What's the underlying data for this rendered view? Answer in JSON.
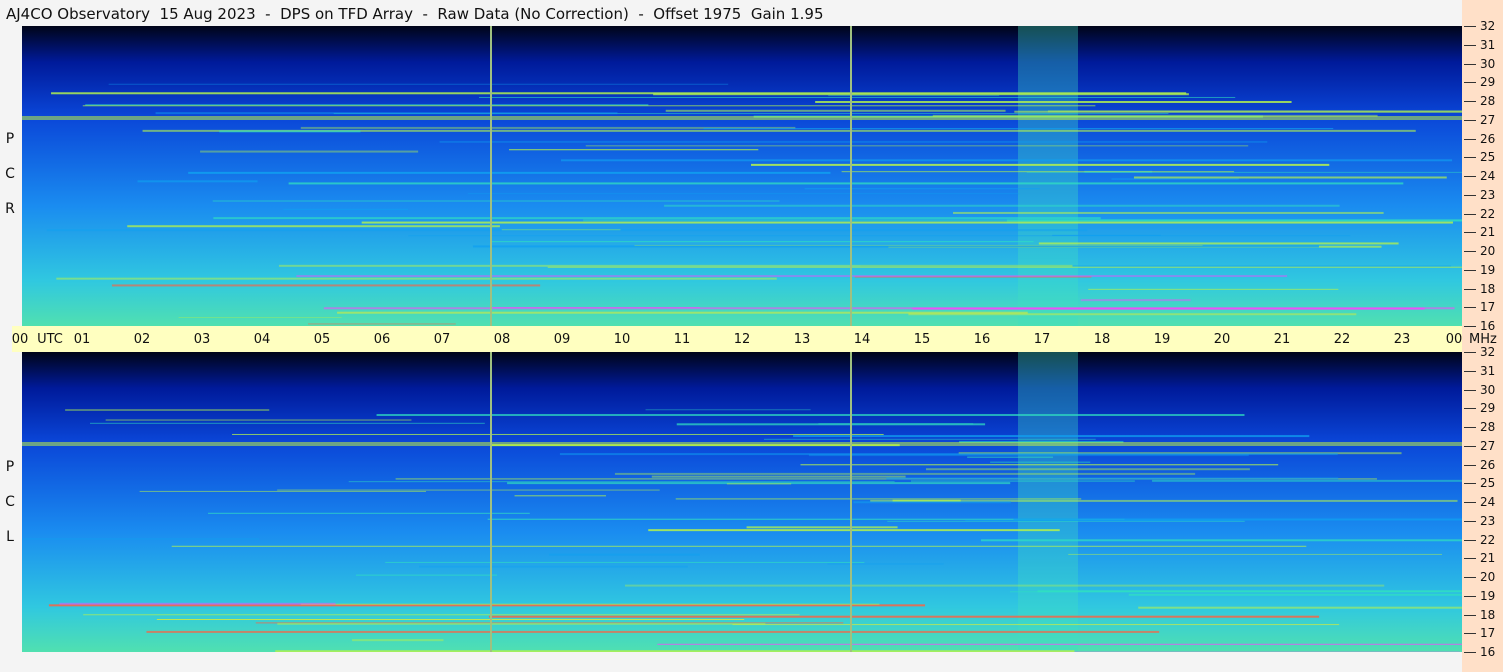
{
  "title": "AJ4CO Observatory  15 Aug 2023  -  DPS on TFD Array  -  Raw Data (No Correction)  -  Offset 1975  Gain 1.95",
  "chart_data": [
    {
      "type": "heatmap",
      "panel": "RCP",
      "side_label": [
        "R",
        "C",
        "P"
      ],
      "x_ticks": [
        "00",
        "01",
        "02",
        "03",
        "04",
        "05",
        "06",
        "07",
        "08",
        "09",
        "10",
        "11",
        "12",
        "13",
        "14",
        "15",
        "16",
        "17",
        "18",
        "19",
        "20",
        "21",
        "22",
        "23",
        "00"
      ],
      "x_unit_label": "UTC",
      "y_ticks": [
        16,
        17,
        18,
        19,
        20,
        21,
        22,
        23,
        24,
        25,
        26,
        27,
        28,
        29,
        30,
        31,
        32
      ],
      "y_unit_label": "MHz",
      "xlim": [
        0,
        24
      ],
      "ylim": [
        16,
        32
      ],
      "colormap": [
        "#000010",
        "#0010a0",
        "#0050e0",
        "#10a0f0",
        "#30e0c0",
        "#b0f050",
        "#f0f020",
        "#ff6040",
        "#ff40ff"
      ],
      "marker_lines_utc": [
        7.8,
        13.8
      ]
    },
    {
      "type": "heatmap",
      "panel": "LCP",
      "side_label": [
        "L",
        "C",
        "P"
      ],
      "x_ticks": [
        "00",
        "01",
        "02",
        "03",
        "04",
        "05",
        "06",
        "07",
        "08",
        "09",
        "10",
        "11",
        "12",
        "13",
        "14",
        "15",
        "16",
        "17",
        "18",
        "19",
        "20",
        "21",
        "22",
        "23",
        "00"
      ],
      "x_unit_label": "UTC",
      "y_ticks": [
        16,
        17,
        18,
        19,
        20,
        21,
        22,
        23,
        24,
        25,
        26,
        27,
        28,
        29,
        30,
        31,
        32
      ],
      "y_unit_label": "MHz",
      "xlim": [
        0,
        24
      ],
      "ylim": [
        16,
        32
      ],
      "colormap": [
        "#000010",
        "#0010a0",
        "#0050e0",
        "#10a0f0",
        "#30e0c0",
        "#b0f050",
        "#f0f020",
        "#ff6040",
        "#ff40ff"
      ],
      "marker_lines_utc": [
        7.8,
        13.8
      ]
    }
  ]
}
